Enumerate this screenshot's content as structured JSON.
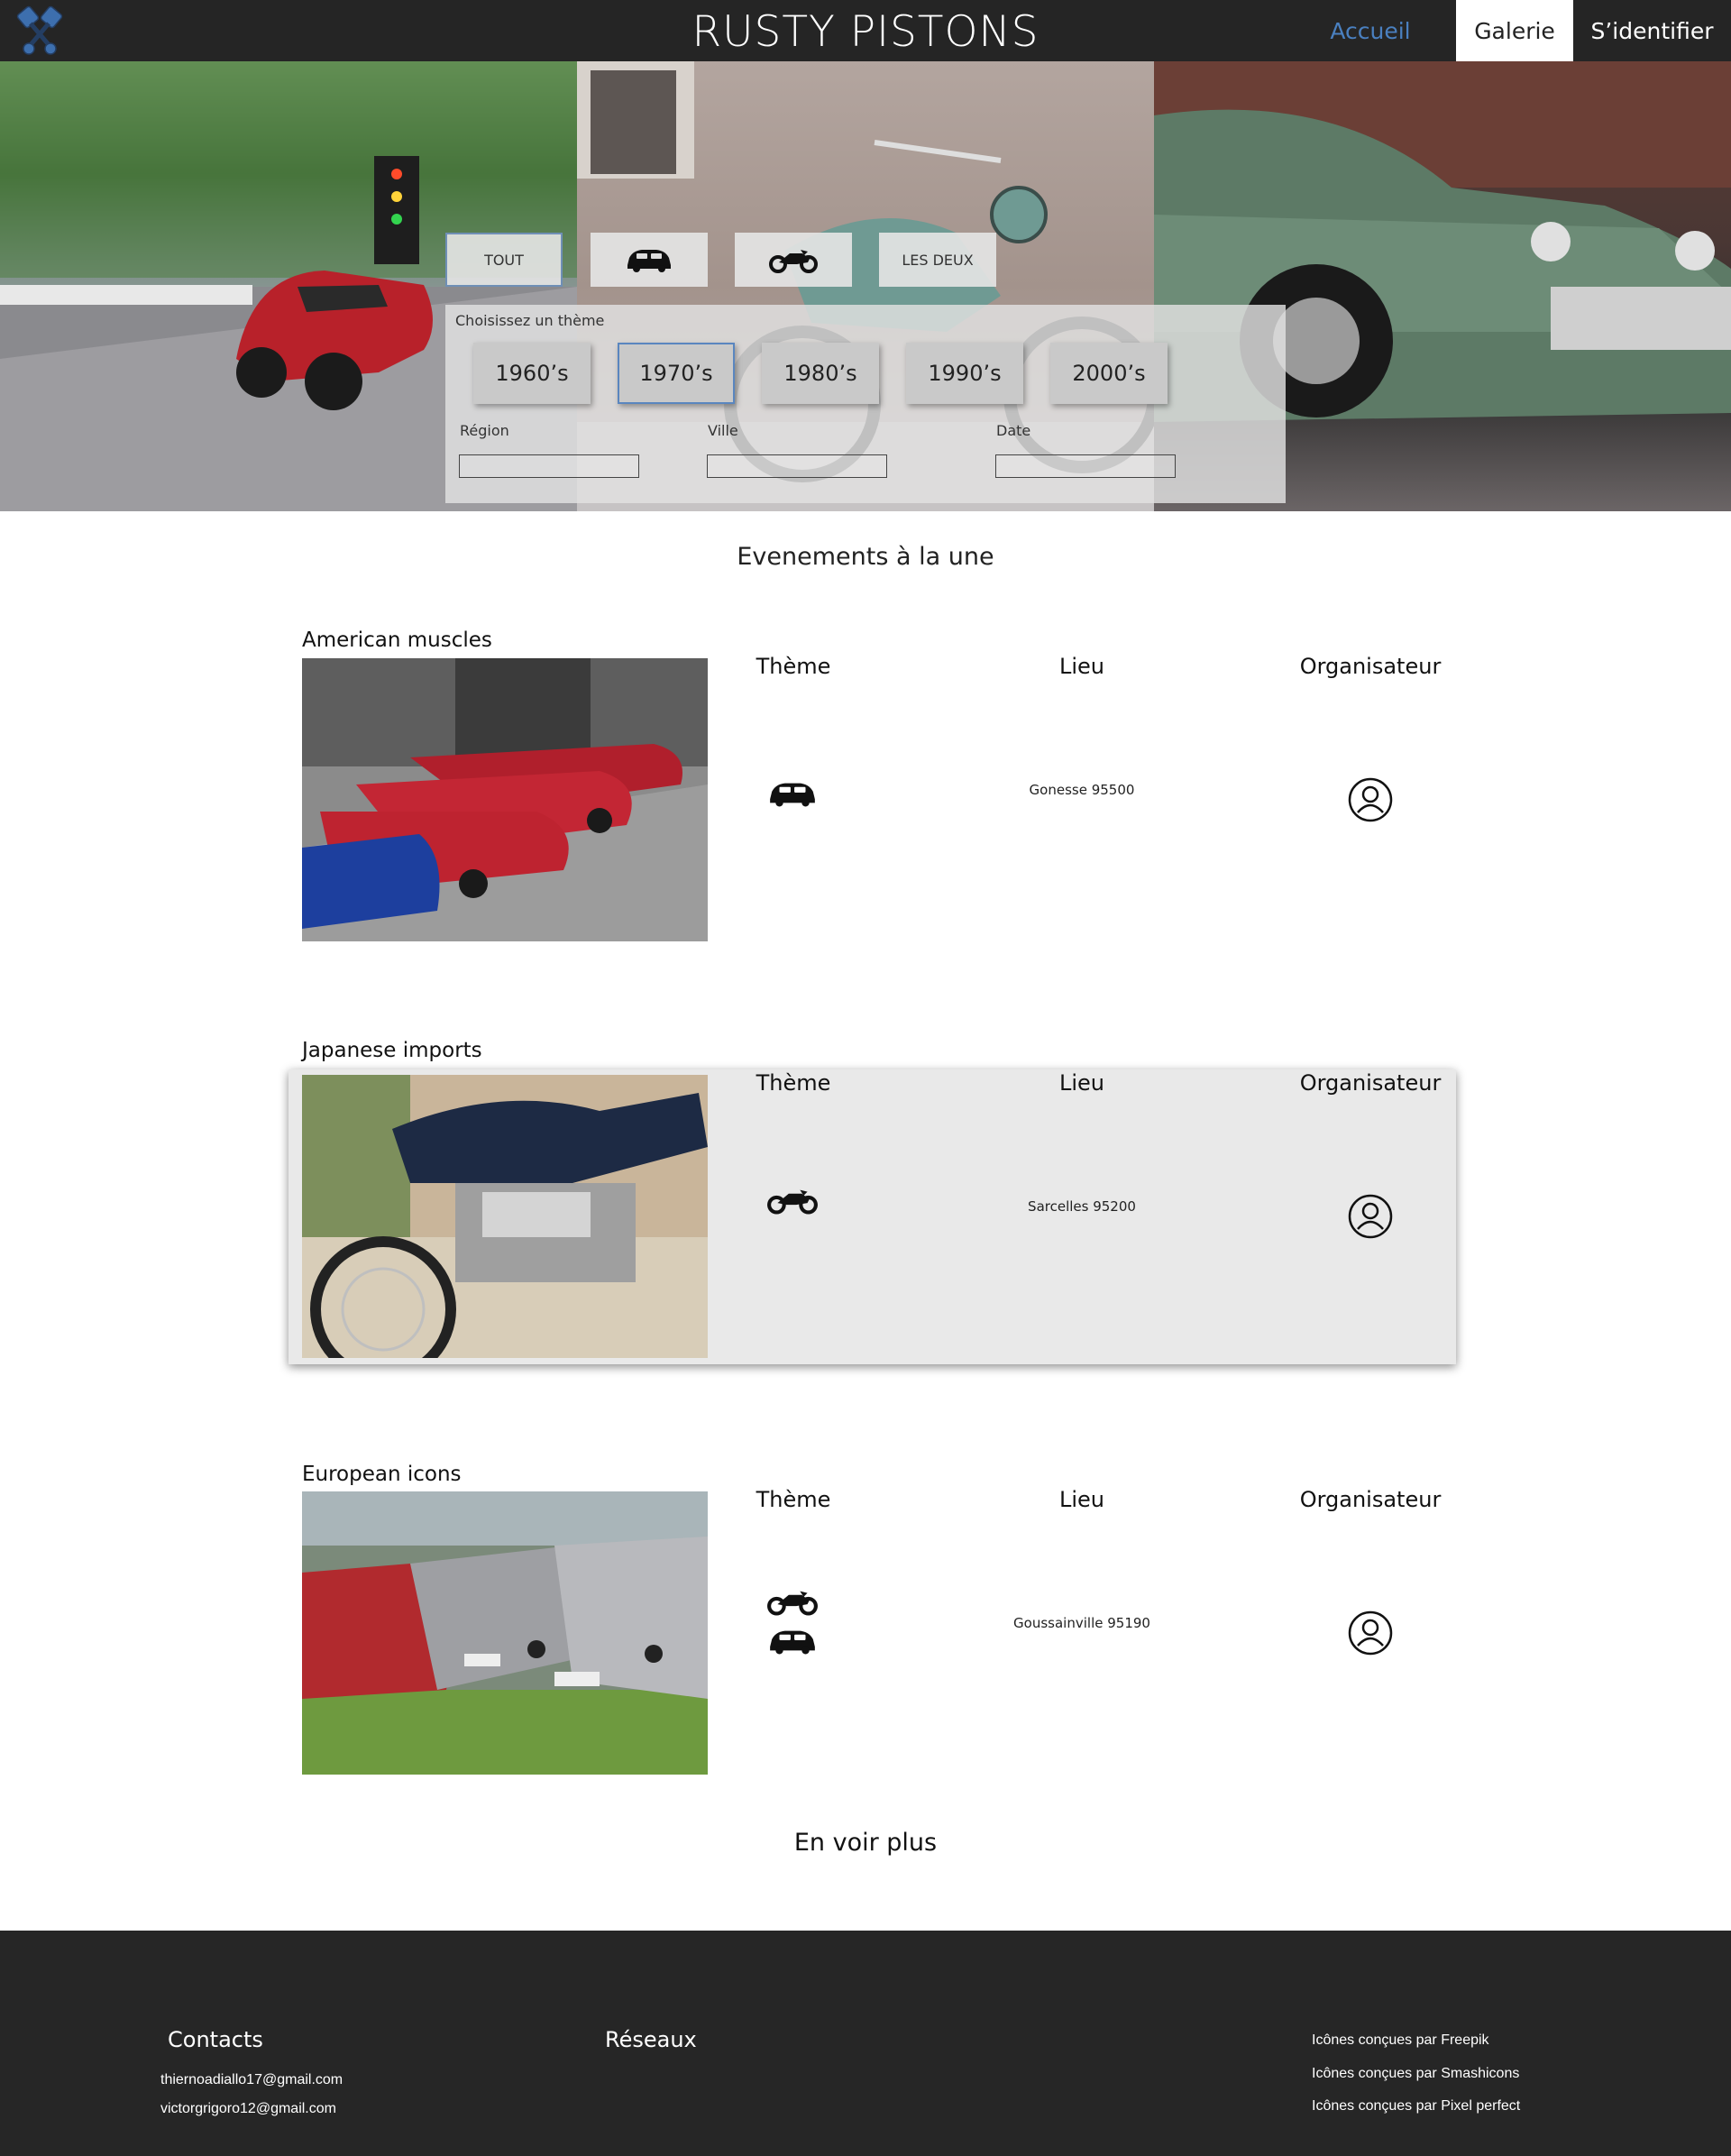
{
  "header": {
    "title": "RUSTY PISTONS",
    "nav": [
      "Accueil",
      "Galerie",
      "S’identifier"
    ],
    "active": "Galerie",
    "accent_color": "#4a80c0",
    "logo_icon": "crossed-pistons-icon"
  },
  "filters": {
    "types": [
      {
        "label": "TOUT"
      },
      {
        "icon": "car-icon"
      },
      {
        "icon": "motorcycle-icon"
      },
      {
        "label": "LES DEUX"
      }
    ],
    "theme_label": "Choisissez un thème",
    "decades": [
      "1960’s",
      "1970’s",
      "1980’s",
      "1990’s",
      "2000’s"
    ],
    "selected_decade": "1970’s",
    "fields": {
      "region": "Région",
      "city": "Ville",
      "date": "Date"
    }
  },
  "events": {
    "section_title": "Evenements à la une",
    "columns": {
      "theme": "Thème",
      "place": "Lieu",
      "organizer": "Organisateur"
    },
    "items": [
      {
        "title": "American muscles",
        "place": "Gonesse 95500",
        "theme_icons": [
          "car-icon"
        ]
      },
      {
        "title": "Japanese imports",
        "place": "Sarcelles 95200",
        "theme_icons": [
          "motorcycle-icon"
        ]
      },
      {
        "title": "European icons",
        "place": "Goussainville 95190",
        "theme_icons": [
          "motorcycle-icon",
          "car-icon"
        ]
      }
    ],
    "more_label": "En voir plus"
  },
  "footer": {
    "contacts_title": "Contacts",
    "emails": [
      "thiernoadiallo17@gmail.com",
      "victorgrigoro12@gmail.com"
    ],
    "networks_title": "Réseaux",
    "credits": [
      "Icônes conçues par Freepik",
      "Icônes conçues par Smashicons",
      "Icônes conçues par Pixel perfect"
    ]
  }
}
